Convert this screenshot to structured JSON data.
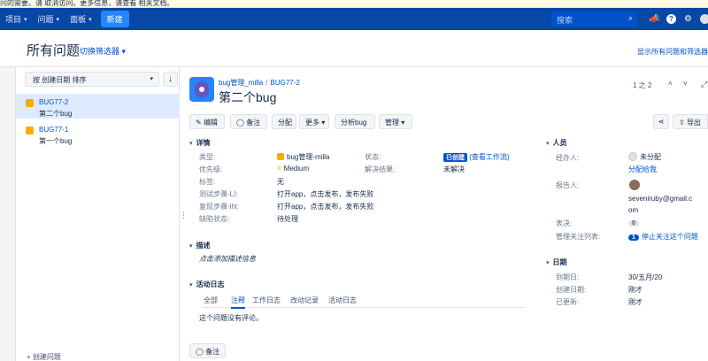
{
  "banner": {
    "text": "问的需要。请 取消访问。更多信息，请查看 相关文档。",
    "link1": "取消访问",
    "link2": "相关文档"
  },
  "topnav": {
    "projects": "项目",
    "issues": "问题",
    "boards": "面板",
    "create": "新建",
    "search_placeholder": "搜索"
  },
  "page": {
    "title": "所有问题",
    "filter_switcher": "切换筛选器",
    "show_all": "显示所有问题和筛选器"
  },
  "list": {
    "sort_label": "按 创建日期 排序",
    "items": [
      {
        "key": "BUG77-2",
        "summary": "第二个bug"
      },
      {
        "key": "BUG77-1",
        "summary": "第一个bug"
      }
    ],
    "create_issue": "+ 创建问题"
  },
  "issue": {
    "project": "bug管理_milla",
    "key": "BUG77-2",
    "title": "第二个bug",
    "pager": "1 之 2",
    "toolbar": {
      "edit": "编辑",
      "comment": "备注",
      "assign": "分配",
      "more": "更多",
      "analyze": "分析bug",
      "manage": "管理",
      "export": "导出"
    },
    "details": {
      "heading": "详情",
      "type_label": "类型:",
      "type_value": "bug管理-milla",
      "priority_label": "优先级:",
      "priority_value": "Medium",
      "labels_label": "标签:",
      "labels_value": "无",
      "test_steps_label": "测试步骤-LI:",
      "test_steps_value": "打开app，点击发布，发布失败",
      "repro_label": "复现步骤-lhl:",
      "repro_value": "打开app，点击发布，发布失败",
      "defect_label": "缺陷状态:",
      "defect_value": "待处理",
      "status_label": "状态:",
      "status_value": "已创建",
      "workflow_link": "(查看工作流)",
      "resolution_label": "解决结果:",
      "resolution_value": "未解决"
    },
    "description": {
      "heading": "描述",
      "placeholder": "点击添加描述信息"
    },
    "activity": {
      "heading": "活动日志",
      "tabs": [
        "全部",
        "注释",
        "工作日志",
        "改动记录",
        "活动日志"
      ],
      "active_tab": "注释",
      "empty": "这个问题没有评论。",
      "comment_button": "备注"
    },
    "people": {
      "heading": "人员",
      "assignee_label": "经办人:",
      "assignee_value": "未分配",
      "assign_to_me": "分配给我",
      "reporter_label": "报告人:",
      "reporter_email_line1": "seveniruby@gmail.c",
      "reporter_email_line2": "om",
      "votes_label": "表决:",
      "votes_value": "0",
      "watchers_label": "管理关注列表:",
      "watchers_count": "1",
      "watchers_action": "停止关注这个问题"
    },
    "dates": {
      "heading": "日期",
      "due_label": "到期日:",
      "due_value": "30/五月/20",
      "created_label": "创建日期:",
      "created_value": "刚才",
      "updated_label": "已更新:",
      "updated_value": "刚才"
    }
  },
  "colors": {
    "topnav": "#0747a6",
    "accent": "#0052cc",
    "bug_icon": "#ffab00"
  }
}
